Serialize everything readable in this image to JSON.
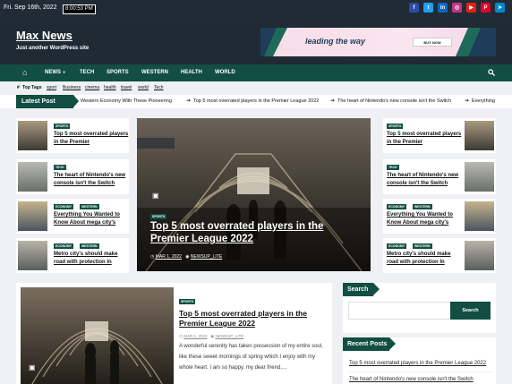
{
  "topbar": {
    "date": "Fri. Sep 16th, 2022",
    "time": "8:00:53 PM",
    "social_colors": [
      "#2c4da3",
      "#1da1f2",
      "#0a66c2",
      "#c13584",
      "#e62117",
      "#e60023",
      "#0088cc"
    ],
    "social_icons": [
      "facebook-icon",
      "twitter-icon",
      "linkedin-icon",
      "instagram-icon",
      "youtube-icon",
      "pinterest-icon",
      "telegram-icon"
    ],
    "social_glyphs": [
      "f",
      "t",
      "in",
      "◎",
      "▶",
      "P",
      "➤"
    ]
  },
  "site": {
    "title": "Max News",
    "tagline": "Just another WordPress site"
  },
  "ad": {
    "text": "leading the way",
    "button": "BUY NOW"
  },
  "nav": {
    "home_icon": "home-icon",
    "items": [
      "NEWS",
      "TECH",
      "SPORTS",
      "WESTERN",
      "HEALTH",
      "WORLD"
    ],
    "search_icon": "search-icon"
  },
  "tags": {
    "label": "Top Tags",
    "items": [
      "sport",
      "Business",
      "cinema",
      "health",
      "travel",
      "world",
      "Tech"
    ]
  },
  "latest": {
    "label": "Latest Post",
    "items": [
      "Western Economy With These Pioneering",
      "Top 5 most overrated players in the Premier League 2022",
      "The heart of Nintendo's new console isn't the Switch",
      "Everything"
    ]
  },
  "left_cards": [
    {
      "cats": [
        "SPORTS"
      ],
      "title": "Top 5 most overrated players in the Premier"
    },
    {
      "cats": [
        "TECH"
      ],
      "title": "The heart of Nintendo's new console isn't the Switch"
    },
    {
      "cats": [
        "ECONOMY",
        "WESTERN"
      ],
      "title": "Everything You Wanted to Know About mega city's"
    },
    {
      "cats": [
        "ECONOMY",
        "WESTERN"
      ],
      "title": "Metro city's should make road with protection In"
    }
  ],
  "right_cards": [
    {
      "cats": [
        "SPORTS"
      ],
      "title": "Top 5 most overrated players in the Premier"
    },
    {
      "cats": [
        "TECH"
      ],
      "title": "The heart of Nintendo's new console isn't the Switch"
    },
    {
      "cats": [
        "ECONOMY",
        "WESTERN"
      ],
      "title": "Everything You Wanted to Know About mega city's"
    },
    {
      "cats": [
        "ECONOMY",
        "WESTERN"
      ],
      "title": "Metro city's should make road with protection In"
    }
  ],
  "hero": {
    "cat": "SPORTS",
    "title": "Top 5 most overrated players in the Premier League 2022",
    "date": "MAR 1, 2022",
    "author": "NEWSUP_LITE"
  },
  "main_post": {
    "cat": "SPORTS",
    "title": "Top 5 most overrated players in the Premier League 2022",
    "date": "MAR 1, 2022",
    "author": "NEWSUP_LITE",
    "excerpt": "A wonderful serenity has taken possession of my entire soul, like these sweet mornings of spring which I enjoy with my whole heart. I am so happy, my dear friend,…"
  },
  "search": {
    "title": "Search",
    "placeholder": "",
    "button": "Search"
  },
  "recent": {
    "title": "Recent Posts",
    "items": [
      "Top 5 most overrated players in the Premier League 2022",
      "The heart of Nintendo's new console isn't the Switch"
    ]
  }
}
